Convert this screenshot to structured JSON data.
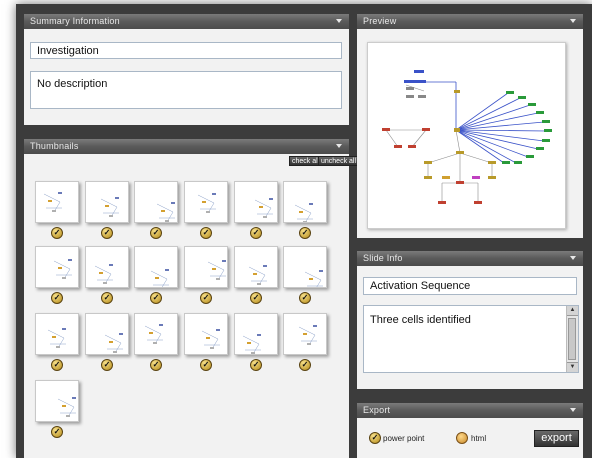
{
  "summary": {
    "title": "Summary Information",
    "name_value": "Investigation",
    "description_value": "No description"
  },
  "thumbnails": {
    "title": "Thumbnails",
    "check_all": "check all",
    "uncheck_all": "uncheck all",
    "count": 19
  },
  "preview": {
    "title": "Preview"
  },
  "slide_info": {
    "title": "Slide Info",
    "name_value": "Activation Sequence",
    "notes_value": "Three cells identified"
  },
  "export": {
    "title": "Export",
    "option_ppt": "power point",
    "option_html": "html",
    "button": "export"
  }
}
